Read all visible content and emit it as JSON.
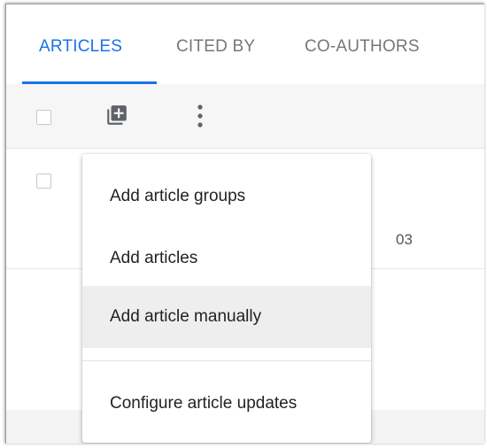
{
  "tabs": [
    {
      "label": "ARTICLES",
      "active": true
    },
    {
      "label": "CITED BY",
      "active": false
    },
    {
      "label": "CO-AUTHORS",
      "active": false
    }
  ],
  "toolbar": {
    "add_icon": "add-box-icon",
    "more_icon": "more-vert-icon"
  },
  "row": {
    "partial_text": "03"
  },
  "menu": {
    "items": [
      {
        "label": "Add article groups"
      },
      {
        "label": "Add articles"
      },
      {
        "label": "Add article manually",
        "highlighted": true
      },
      {
        "label": "Configure article updates"
      }
    ]
  },
  "colors": {
    "accent": "#1a73e8",
    "tab_inactive": "#777777",
    "menu_hover": "#eeeeee"
  }
}
